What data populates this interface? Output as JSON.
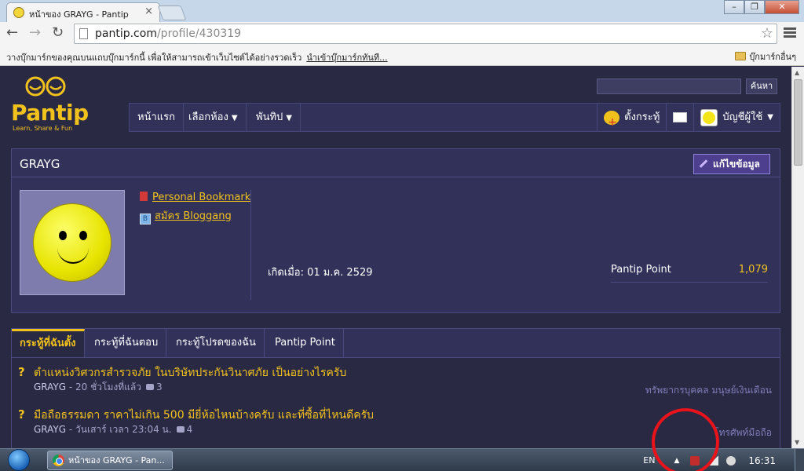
{
  "browser": {
    "tab_title": "หน้าของ GRAYG - Pantip",
    "tab_close": "×",
    "url_host": "pantip.com",
    "url_path": "/profile/430319",
    "bookmark_message": "วางบุ๊กมาร์กของคุณบนแถบบุ๊กมาร์กนี้ เพื่อให้สามารถเข้าเว็บไซต์ได้อย่างรวดเร็ว",
    "bookmark_import_link": "นำเข้าบุ๊กมาร์กทันที...",
    "other_bookmarks": "บุ๊กมาร์กอื่นๆ",
    "nav_back": "←",
    "nav_forward": "→",
    "nav_reload": "↻",
    "star": "☆",
    "win_minimize": "–",
    "win_maximize": "❐",
    "win_close": "✕"
  },
  "site": {
    "logo_text": "Pantip",
    "logo_tagline": "Learn, Share & Fun",
    "search_button": "ค้นหา",
    "nav": [
      "หน้าแรก",
      "เลือกห้อง",
      "พันทิป"
    ],
    "nav_caret": "▼",
    "create_topic": "ตั้งกระทู้",
    "account": "บัญชีผู้ใช้"
  },
  "profile": {
    "name": "GRAYG",
    "edit_button": "แก้ไขข้อมูล",
    "links": [
      "Personal Bookmark",
      "สมัคร Bloggang"
    ],
    "birth": "เกิดเมื่อ: 01 ม.ค. 2529",
    "point_label": "Pantip Point",
    "point_value": "1,079"
  },
  "tabs": [
    "กระทู้ที่ฉันตั้ง",
    "กระทู้ที่ฉันตอบ",
    "กระทู้โปรดของฉัน",
    "Pantip Point"
  ],
  "topics": [
    {
      "title": "ตำแหน่งวิศวกรสำรวจภัย ในบริษัทประกันวินาศภัย เป็นอย่างไรครับ",
      "author": "GRAYG",
      "time": "- 20 ชั่วโมงที่แล้ว",
      "comments": "3",
      "tags": "ทรัพยากรบุคคล  มนุษย์เงินเดือน"
    },
    {
      "title": "มือถือธรรมดา ราคาไม่เกิน 500 มียี่ห้อไหนบ้างครับ และที่ซื้อที่ไหนดีครับ",
      "author": "GRAYG",
      "time": "- วันเสาร์ เวลา 23:04 น.",
      "comments": "4",
      "tags": "โทรศัพท์มือถือ"
    }
  ],
  "taskbar": {
    "item": "หน้าของ GRAYG - Pan...",
    "lang": "EN",
    "tray_arrow": "▲",
    "clock": "16:31"
  },
  "colors": {
    "accent": "#f2c21c",
    "page_bg": "#2a2944",
    "panel_bg": "#32315a",
    "annotation_circle": "#e8131b"
  }
}
